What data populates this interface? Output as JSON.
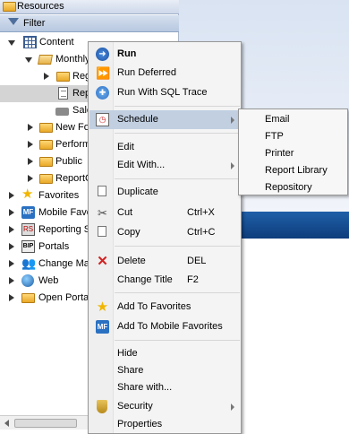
{
  "panel": {
    "header_title": "Resources",
    "filter_label": "Filter"
  },
  "tree": {
    "content": "Content",
    "monthly": "Monthly",
    "item_reg": "Reg",
    "item_rep": "Rep",
    "item_sales": "Sale",
    "new_folder": "New Fo",
    "performance": "Perform",
    "public": "Public",
    "report_c": "ReportC",
    "favorites": "Favorites",
    "mobile_favorites": "Mobile Favo",
    "reporting_server": "Reporting S",
    "portals": "Portals",
    "change_management": "Change Mar",
    "web": "Web",
    "open_portal": "Open Porta"
  },
  "menu": {
    "run": "Run",
    "run_deferred": "Run Deferred",
    "run_sql_trace": "Run With SQL Trace",
    "schedule": "Schedule",
    "edit": "Edit",
    "edit_with": "Edit With...",
    "duplicate": "Duplicate",
    "cut": "Cut",
    "cut_shortcut": "Ctrl+X",
    "copy": "Copy",
    "copy_shortcut": "Ctrl+C",
    "delete": "Delete",
    "delete_shortcut": "DEL",
    "change_title": "Change Title",
    "change_title_shortcut": "F2",
    "add_favorites": "Add To Favorites",
    "add_mobile_favorites": "Add To Mobile Favorites",
    "hide": "Hide",
    "share": "Share",
    "share_with": "Share with...",
    "security": "Security",
    "properties": "Properties"
  },
  "submenu": {
    "email": "Email",
    "ftp": "FTP",
    "printer": "Printer",
    "report_library": "Report Library",
    "repository": "Repository"
  },
  "icons": {
    "mobile_fav_badge": "MF",
    "reporting_badge": "RS",
    "portal_badge": "BIP"
  },
  "colors": {
    "highlight": "#c1cfe1",
    "band": "#0e3d7c",
    "delete_red": "#d21f1f",
    "favorite_gold": "#f1b600"
  }
}
